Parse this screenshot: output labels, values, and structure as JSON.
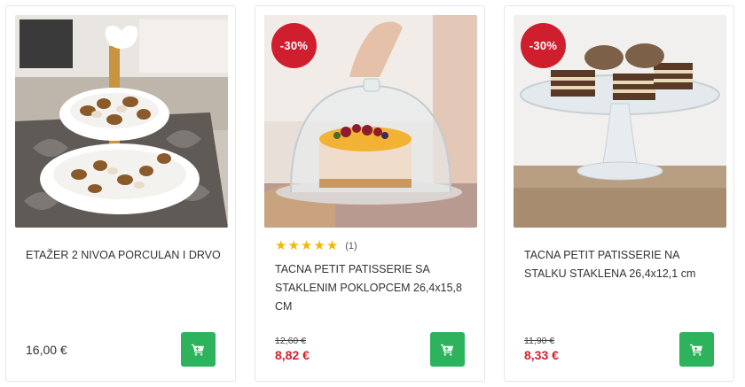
{
  "products": [
    {
      "title": "ETAŽER 2 NIVOA PORCULAN I DRVO",
      "price": "16,00 €",
      "image_icon": "cake-stand-porcelain-icon"
    },
    {
      "badge": "-30%",
      "rating_stars": 5,
      "rating_count": "(1)",
      "title": "TACNA PETIT PATISSERIE SA STAKLENIM POKLOPCEM 26,4x15,8 CM",
      "old_price": "12,60 €",
      "new_price": "8,82 €",
      "image_icon": "glass-dome-cake-icon"
    },
    {
      "badge": "-30%",
      "title": "TACNA PETIT PATISSERIE NA STALKU STAKLENA 26,4x12,1 cm",
      "old_price": "11,90 €",
      "new_price": "8,33 €",
      "image_icon": "glass-stand-cakes-icon"
    }
  ],
  "colors": {
    "badge": "#cf1f2e",
    "cart_button": "#2db35c",
    "sale_price": "#d6202c",
    "star": "#f5b800"
  }
}
